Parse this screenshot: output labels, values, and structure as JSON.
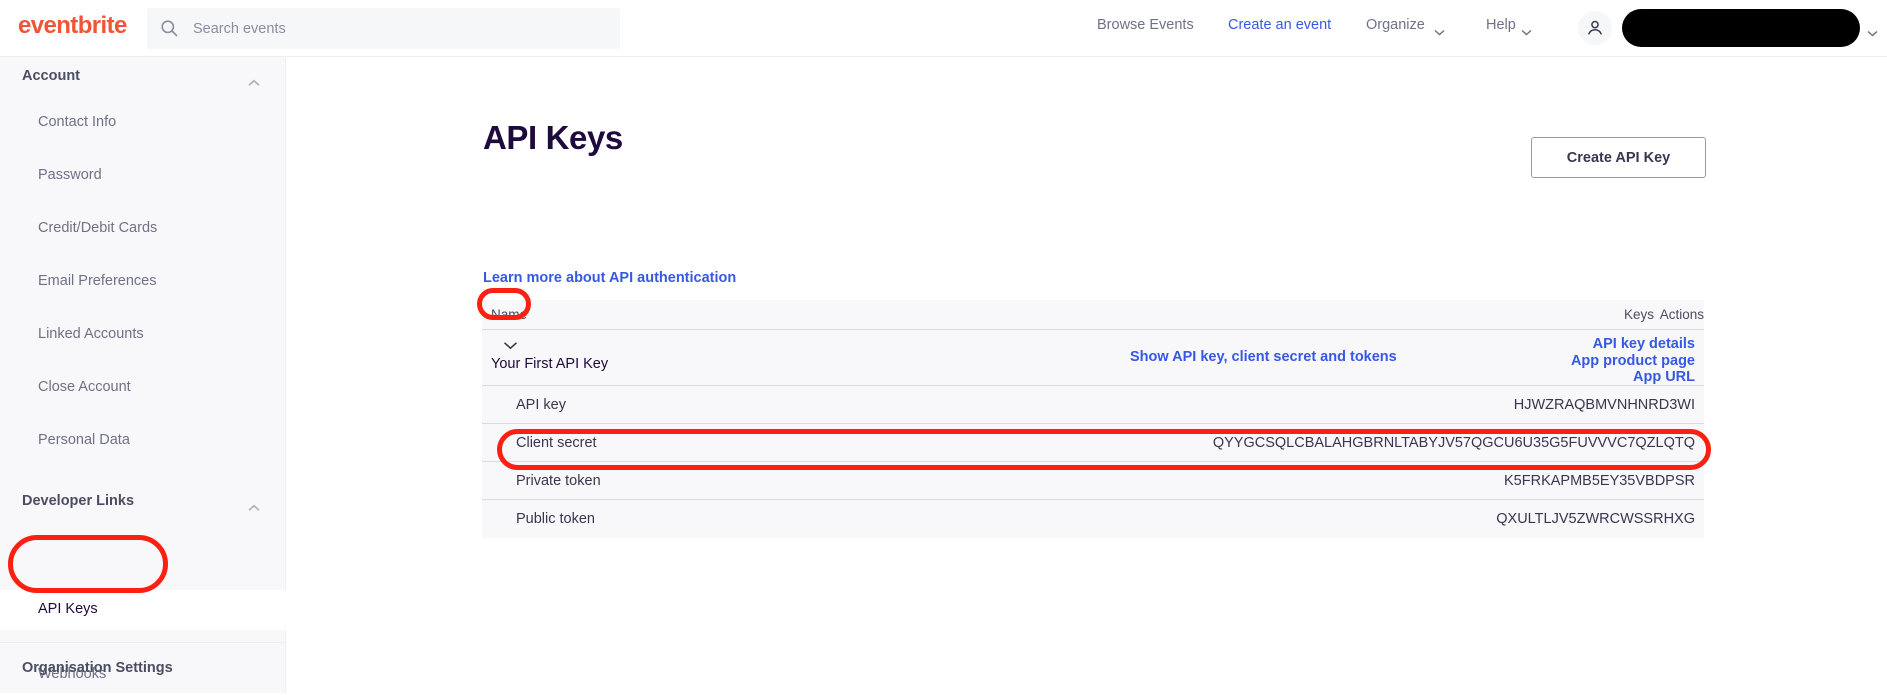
{
  "topnav": {
    "brand": "eventbrite",
    "brand_color": "#f05537",
    "search": {
      "placeholder": "Search events",
      "value": "",
      "icon": "search-icon"
    },
    "links": [
      {
        "label": "Browse Events",
        "accent": false
      },
      {
        "label": "Create an event",
        "accent": true
      },
      {
        "label": "Organize",
        "accent": false,
        "chevron": "chevron-down-icon"
      },
      {
        "label": "Help",
        "accent": false,
        "chevron": "chevron-down-icon"
      }
    ],
    "accent_color": "#3659e3",
    "avatar_icon": "user-icon",
    "account_name": "",
    "account_name_redacted": true,
    "account_chevron": "chevron-down-icon"
  },
  "sidebar": {
    "sections": [
      {
        "label": "Account",
        "chevron": "chevron-up-icon",
        "items": [
          {
            "label": "Contact Info",
            "active": false
          },
          {
            "label": "Password",
            "active": false
          },
          {
            "label": "Credit/Debit Cards",
            "active": false
          },
          {
            "label": "Email Preferences",
            "active": false
          },
          {
            "label": "Linked Accounts",
            "active": false
          },
          {
            "label": "Close Account",
            "active": false
          },
          {
            "label": "Personal Data",
            "active": false
          }
        ]
      },
      {
        "label": "Developer Links",
        "chevron": "chevron-up-icon",
        "items": [
          {
            "label": "API Keys",
            "active": true
          },
          {
            "label": "Webhooks",
            "active": false
          }
        ]
      },
      {
        "label": "Organisation Settings",
        "chevron": "",
        "items": []
      }
    ]
  },
  "main": {
    "page_title": "API Keys",
    "create_button_label": "Create API Key",
    "learn_more_label": "Learn more about API authentication",
    "table": {
      "headers": {
        "name": "Name",
        "keys": "Keys",
        "actions": "Actions"
      },
      "key": {
        "name": "Your First API Key",
        "expand_icon": "chevron-down-icon",
        "expanded": true,
        "show_secrets_label": "Show API key, client secret and tokens",
        "actions": [
          "API key details",
          "App product page",
          "App URL"
        ],
        "details": [
          {
            "label": "API key",
            "value": "HJWZRAQBMVNHNRD3WI",
            "highlighted": false
          },
          {
            "label": "Client secret",
            "value": "QYYGCSQLCBALAHGBRNLTABYJV57QGCU6U35G5FUVVVC7QZLQTQ",
            "highlighted": false
          },
          {
            "label": "Private token",
            "value": "K5FRKAPMB5EY35VBDPSR",
            "highlighted": true
          },
          {
            "label": "Public token",
            "value": "QXULTLJV5ZWRCWSSRHXG",
            "highlighted": false
          }
        ]
      }
    }
  },
  "annotations": {
    "color": "#fb2012",
    "shapes": [
      {
        "target": "sidebar-item-api-keys",
        "shape": "oval"
      },
      {
        "target": "expand-toggle",
        "shape": "oval"
      },
      {
        "target": "private-token-row",
        "shape": "oval"
      }
    ]
  }
}
